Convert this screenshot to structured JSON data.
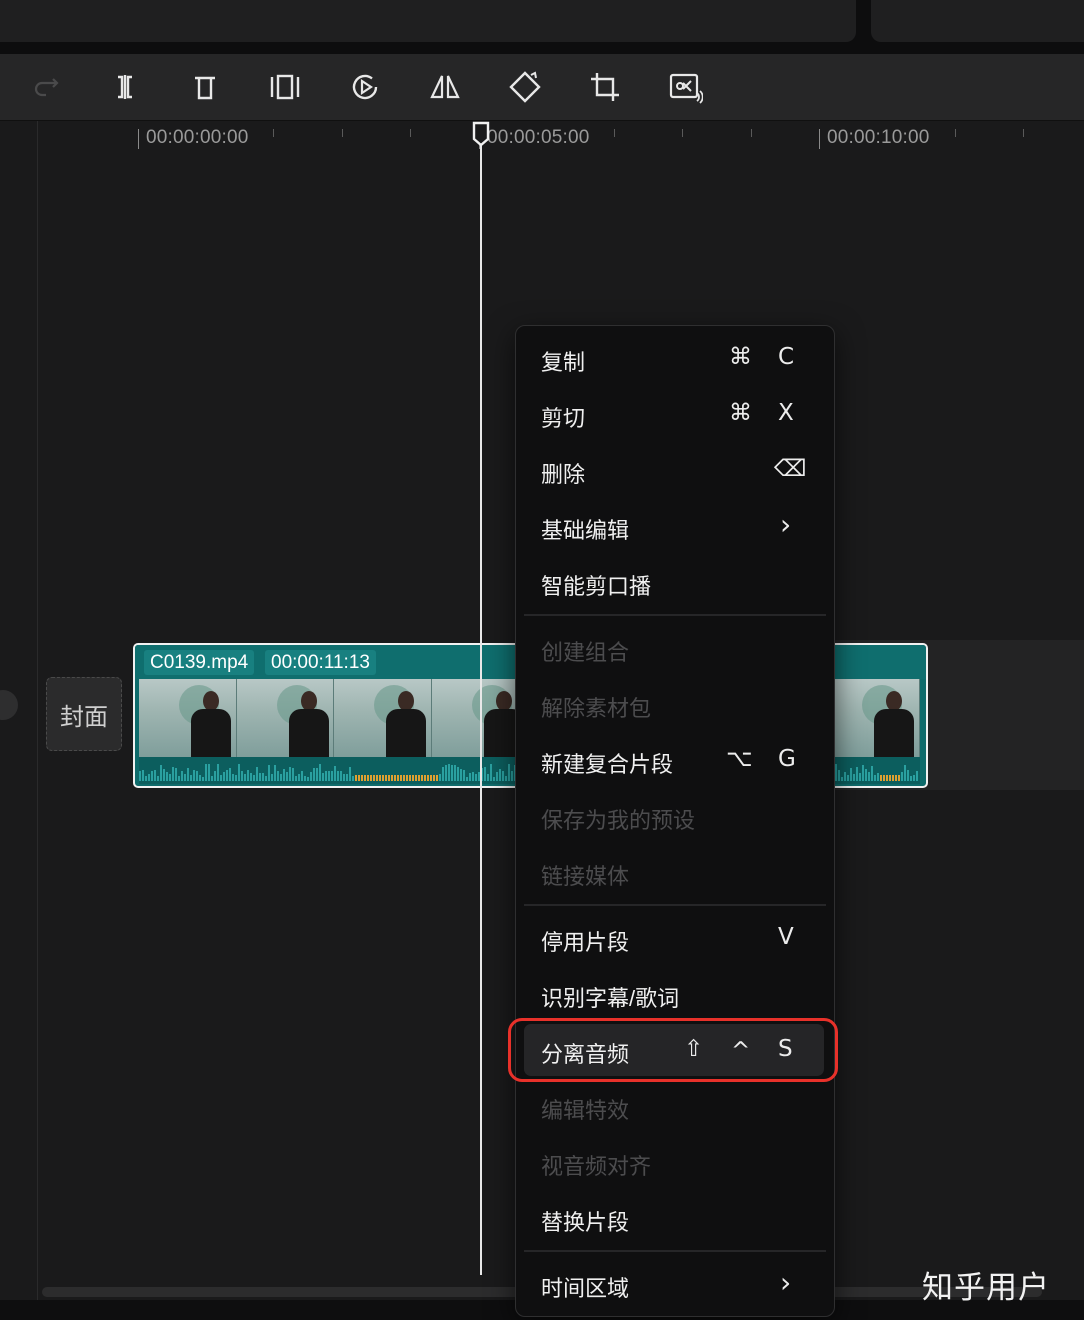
{
  "ruler": {
    "labels": [
      "00:00:00:00",
      "00:00:05:00",
      "00:00:10:00"
    ]
  },
  "toolbar": {
    "icons": [
      "redo-icon",
      "split-icon",
      "delete-icon",
      "freeze-icon",
      "play-reverse-icon",
      "mirror-icon",
      "rotate-icon",
      "crop-icon",
      "remove-bg-icon"
    ]
  },
  "track": {
    "cover_label": "封面",
    "clip_name": "C0139.mp4",
    "clip_duration": "00:00:11:13"
  },
  "menu": {
    "items": [
      {
        "label": "复制",
        "shortcut": [
          "⌘",
          "C"
        ],
        "enabled": true
      },
      {
        "label": "剪切",
        "shortcut": [
          "⌘",
          "X"
        ],
        "enabled": true
      },
      {
        "label": "删除",
        "shortcut": [
          "⌫"
        ],
        "enabled": true
      },
      {
        "label": "基础编辑",
        "shortcut": [
          "›"
        ],
        "enabled": true
      },
      {
        "label": "智能剪口播",
        "shortcut": [],
        "enabled": true
      },
      {
        "label": "创建组合",
        "shortcut": [],
        "enabled": false
      },
      {
        "label": "解除素材包",
        "shortcut": [],
        "enabled": false
      },
      {
        "label": "新建复合片段",
        "shortcut": [
          "⌥",
          "G"
        ],
        "enabled": true
      },
      {
        "label": "保存为我的预设",
        "shortcut": [],
        "enabled": false
      },
      {
        "label": "链接媒体",
        "shortcut": [],
        "enabled": false
      },
      {
        "label": "停用片段",
        "shortcut": [
          "V"
        ],
        "enabled": true
      },
      {
        "label": "识别字幕/歌词",
        "shortcut": [],
        "enabled": true
      },
      {
        "label": "分离音频",
        "shortcut": [
          "⇧",
          "^",
          "S"
        ],
        "enabled": true,
        "highlighted": true
      },
      {
        "label": "编辑特效",
        "shortcut": [],
        "enabled": false
      },
      {
        "label": "视音频对齐",
        "shortcut": [],
        "enabled": false
      },
      {
        "label": "替换片段",
        "shortcut": [],
        "enabled": true
      },
      {
        "label": "时间区域",
        "shortcut": [
          "›"
        ],
        "enabled": true
      }
    ]
  },
  "watermark": "知乎用户",
  "colors": {
    "clip_teal": "#0e6b6b",
    "highlight_outline": "#e8312a",
    "menu_bg": "#0f0f10"
  }
}
